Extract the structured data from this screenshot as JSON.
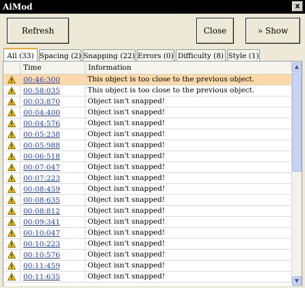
{
  "window": {
    "title": "AiMod",
    "close_glyph": "x"
  },
  "toolbar": {
    "refresh_label": "Refresh",
    "close_label": "Close",
    "show_label": "» Show"
  },
  "tabs": [
    {
      "label": "All (33)",
      "active": true
    },
    {
      "label": "Spacing (2)",
      "active": false
    },
    {
      "label": "Snapping (22)",
      "active": false
    },
    {
      "label": "Errors (0)",
      "active": false
    },
    {
      "label": "Difficulty (8)",
      "active": false
    },
    {
      "label": "Style (1)",
      "active": false
    }
  ],
  "table": {
    "columns": [
      "",
      "Time",
      "Information"
    ],
    "row_icon": "warning-icon",
    "rows": [
      {
        "time": "00:46:300",
        "info": "This object is too close to the previous object.",
        "selected": true
      },
      {
        "time": "00:58:035",
        "info": "This object is too close to the previous object."
      },
      {
        "time": "00:03:870",
        "info": "Object isn't snapped!"
      },
      {
        "time": "00:04:400",
        "info": "Object isn't snapped!"
      },
      {
        "time": "00:04:576",
        "info": "Object isn't snapped!"
      },
      {
        "time": "00:05:238",
        "info": "Object isn't snapped!"
      },
      {
        "time": "00:05:988",
        "info": "Object isn't snapped!"
      },
      {
        "time": "00:06:518",
        "info": "Object isn't snapped!"
      },
      {
        "time": "00:07:047",
        "info": "Object isn't snapped!"
      },
      {
        "time": "00:07:223",
        "info": "Object isn't snapped!"
      },
      {
        "time": "00:08:459",
        "info": "Object isn't snapped!"
      },
      {
        "time": "00:08:635",
        "info": "Object isn't snapped!"
      },
      {
        "time": "00:08:812",
        "info": "Object isn't snapped!"
      },
      {
        "time": "00:09:341",
        "info": "Object isn't snapped!"
      },
      {
        "time": "00:10:047",
        "info": "Object isn't snapped!"
      },
      {
        "time": "00:10:223",
        "info": "Object isn't snapped!"
      },
      {
        "time": "00:10:576",
        "info": "Object isn't snapped!"
      },
      {
        "time": "00:11:459",
        "info": "Object isn't snapped!"
      },
      {
        "time": "00:11:635",
        "info": "Object isn't snapped!"
      }
    ]
  },
  "colors": {
    "title_bg": "#000000",
    "selected_row": "#fcd9a8",
    "link": "#1f3fb5",
    "warning": "#f5c400",
    "active_tab": "#f0a830"
  }
}
